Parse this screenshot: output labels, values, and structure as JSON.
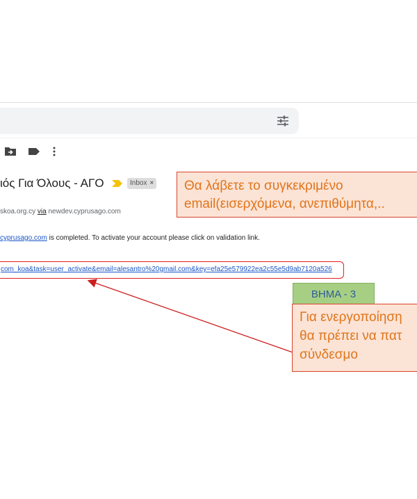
{
  "search": {
    "icon": "tune-icon"
  },
  "toolbar": {
    "icons": [
      "move-to-icon",
      "label-icon",
      "more-vert-icon"
    ]
  },
  "email": {
    "subject": "ιός Για Όλους - ΑΓΟ",
    "label_chip": "Inbox",
    "label_chip_close": "×",
    "sender_prefix": "skoa.org.cy",
    "sender_via": "via",
    "sender_domain": "newdev.cyprusago.com",
    "body_link_text": "cyprusago.com",
    "body_text": " is completed. To activate your account please click on validation link.",
    "activation_link": "com_koa&task=user_activate&email=alesantro%20gmail.com&key=efa25e579922ea2c55e5d9ab7120a526"
  },
  "annotations": {
    "callout_top_line1": "Θα λάβετε το συγκεκριμένο",
    "callout_top_line2": "email(εισερχόμενα, ανεπιθύμητα,..",
    "step_label": "ΒΗΜΑ - 3",
    "callout_bottom_line1": "Για ενεργοποίηση",
    "callout_bottom_line2": "θα πρέπει να πατ",
    "callout_bottom_line3": "σύνδεσμο"
  },
  "colors": {
    "callout_fill": "#fbe3d6",
    "callout_border": "#d9442c",
    "callout_text": "#e0751a",
    "step_fill": "#a6cf84",
    "step_text": "#2f5c98",
    "link": "#1a55c8",
    "highlight_border": "#e02020"
  }
}
